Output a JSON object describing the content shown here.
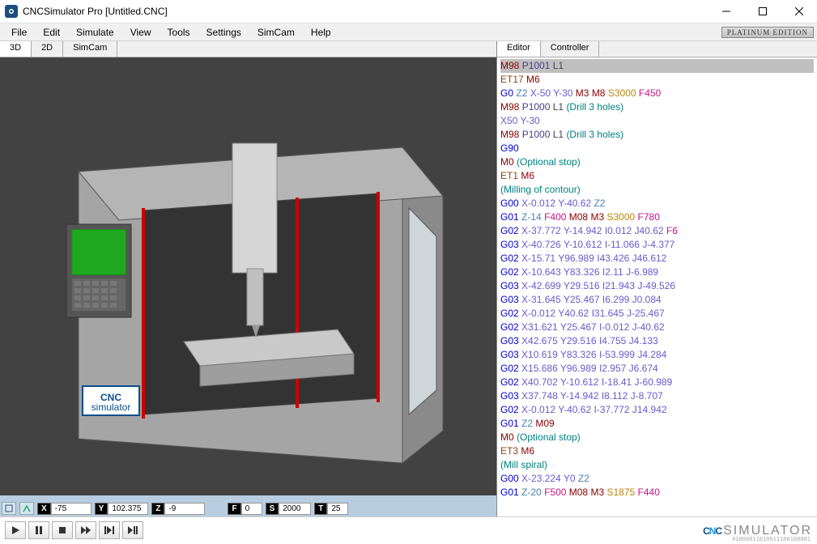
{
  "window": {
    "title": "CNCSimulator Pro [Untitled.CNC]",
    "edition_badge": "PLATINUM EDITION"
  },
  "menu": {
    "items": [
      "File",
      "Edit",
      "Simulate",
      "View",
      "Tools",
      "Settings",
      "SimCam",
      "Help"
    ]
  },
  "view_tabs": {
    "items": [
      "3D",
      "2D",
      "SimCam"
    ],
    "active_index": 0
  },
  "editor_tabs": {
    "items": [
      "Editor",
      "Controller"
    ],
    "active_index": 0
  },
  "status": {
    "X": {
      "label": "X",
      "value": "-75"
    },
    "Y": {
      "label": "Y",
      "value": "102.375"
    },
    "Z": {
      "label": "Z",
      "value": "-9"
    },
    "F": {
      "label": "F",
      "value": "0"
    },
    "S": {
      "label": "S",
      "value": "2000"
    },
    "T": {
      "label": "T",
      "value": "25"
    }
  },
  "code_lines": [
    {
      "hl": true,
      "tokens": [
        [
          "m",
          "M98"
        ],
        [
          "plain",
          " "
        ],
        [
          "p",
          "P1001"
        ],
        [
          "plain",
          " "
        ],
        [
          "l",
          "L1"
        ]
      ]
    },
    {
      "tokens": [
        [
          "et",
          "ET17"
        ],
        [
          "plain",
          " "
        ],
        [
          "m",
          "M6"
        ]
      ]
    },
    {
      "tokens": [
        [
          "g",
          "G0"
        ],
        [
          "plain",
          " "
        ],
        [
          "z",
          "Z2"
        ],
        [
          "plain",
          " "
        ],
        [
          "coord",
          "X-50"
        ],
        [
          "plain",
          " "
        ],
        [
          "coord",
          "Y-30"
        ],
        [
          "plain",
          " "
        ],
        [
          "m",
          "M3"
        ],
        [
          "plain",
          " "
        ],
        [
          "m",
          "M8"
        ],
        [
          "plain",
          " "
        ],
        [
          "s",
          "S3000"
        ],
        [
          "plain",
          " "
        ],
        [
          "f",
          "F450"
        ]
      ]
    },
    {
      "tokens": [
        [
          "m",
          "M98"
        ],
        [
          "plain",
          " "
        ],
        [
          "p",
          "P1000"
        ],
        [
          "plain",
          " "
        ],
        [
          "l",
          "L1"
        ],
        [
          "plain",
          " "
        ],
        [
          "comment",
          "(Drill 3 holes)"
        ]
      ]
    },
    {
      "tokens": [
        [
          "coord",
          "X50"
        ],
        [
          "plain",
          " "
        ],
        [
          "coord",
          "Y-30"
        ]
      ]
    },
    {
      "tokens": [
        [
          "m",
          "M98"
        ],
        [
          "plain",
          " "
        ],
        [
          "p",
          "P1000"
        ],
        [
          "plain",
          " "
        ],
        [
          "l",
          "L1"
        ],
        [
          "plain",
          " "
        ],
        [
          "comment",
          "(Drill 3 holes)"
        ]
      ]
    },
    {
      "tokens": [
        [
          "g",
          "G90"
        ]
      ]
    },
    {
      "tokens": [
        [
          "m",
          "M0"
        ],
        [
          "plain",
          " "
        ],
        [
          "comment",
          "(Optional stop)"
        ]
      ]
    },
    {
      "tokens": [
        [
          "et",
          "ET1"
        ],
        [
          "plain",
          " "
        ],
        [
          "m",
          "M6"
        ]
      ]
    },
    {
      "tokens": [
        [
          "comment",
          "(Milling of contour)"
        ]
      ]
    },
    {
      "tokens": [
        [
          "g",
          "G00"
        ],
        [
          "plain",
          " "
        ],
        [
          "coord",
          "X-0.012"
        ],
        [
          "plain",
          " "
        ],
        [
          "coord",
          "Y-40.62"
        ],
        [
          "plain",
          " "
        ],
        [
          "z",
          "Z2"
        ]
      ]
    },
    {
      "tokens": [
        [
          "g",
          "G01"
        ],
        [
          "plain",
          " "
        ],
        [
          "z",
          "Z-14"
        ],
        [
          "plain",
          " "
        ],
        [
          "f",
          "F400"
        ],
        [
          "plain",
          " "
        ],
        [
          "m",
          "M08"
        ],
        [
          "plain",
          " "
        ],
        [
          "m",
          "M3"
        ],
        [
          "plain",
          " "
        ],
        [
          "s",
          "S3000"
        ],
        [
          "plain",
          " "
        ],
        [
          "f",
          "F780"
        ]
      ]
    },
    {
      "tokens": [
        [
          "g",
          "G02"
        ],
        [
          "plain",
          " "
        ],
        [
          "coord",
          "X-37.772"
        ],
        [
          "plain",
          " "
        ],
        [
          "coord",
          "Y-14.942"
        ],
        [
          "plain",
          " "
        ],
        [
          "coord",
          "I0.012"
        ],
        [
          "plain",
          " "
        ],
        [
          "coord",
          "J40.62"
        ],
        [
          "plain",
          " "
        ],
        [
          "f",
          "F6"
        ]
      ]
    },
    {
      "tokens": [
        [
          "g",
          "G03"
        ],
        [
          "plain",
          " "
        ],
        [
          "coord",
          "X-40.726"
        ],
        [
          "plain",
          " "
        ],
        [
          "coord",
          "Y-10.612"
        ],
        [
          "plain",
          " "
        ],
        [
          "coord",
          "I-11.066"
        ],
        [
          "plain",
          " "
        ],
        [
          "coord",
          "J-4.377"
        ]
      ]
    },
    {
      "tokens": [
        [
          "g",
          "G02"
        ],
        [
          "plain",
          " "
        ],
        [
          "coord",
          "X-15.71"
        ],
        [
          "plain",
          " "
        ],
        [
          "coord",
          "Y96.989"
        ],
        [
          "plain",
          " "
        ],
        [
          "coord",
          "I43.426"
        ],
        [
          "plain",
          " "
        ],
        [
          "coord",
          "J46.612"
        ]
      ]
    },
    {
      "tokens": [
        [
          "g",
          "G02"
        ],
        [
          "plain",
          " "
        ],
        [
          "coord",
          "X-10.643"
        ],
        [
          "plain",
          " "
        ],
        [
          "coord",
          "Y83.326"
        ],
        [
          "plain",
          " "
        ],
        [
          "coord",
          "I2.11"
        ],
        [
          "plain",
          " "
        ],
        [
          "coord",
          "J-6.989"
        ]
      ]
    },
    {
      "tokens": [
        [
          "g",
          "G03"
        ],
        [
          "plain",
          " "
        ],
        [
          "coord",
          "X-42.699"
        ],
        [
          "plain",
          " "
        ],
        [
          "coord",
          "Y29.516"
        ],
        [
          "plain",
          " "
        ],
        [
          "coord",
          "I21.943"
        ],
        [
          "plain",
          " "
        ],
        [
          "coord",
          "J-49.526"
        ]
      ]
    },
    {
      "tokens": [
        [
          "g",
          "G03"
        ],
        [
          "plain",
          " "
        ],
        [
          "coord",
          "X-31.645"
        ],
        [
          "plain",
          " "
        ],
        [
          "coord",
          "Y25.467"
        ],
        [
          "plain",
          " "
        ],
        [
          "coord",
          "I6.299"
        ],
        [
          "plain",
          " "
        ],
        [
          "coord",
          "J0.084"
        ]
      ]
    },
    {
      "tokens": [
        [
          "g",
          "G02"
        ],
        [
          "plain",
          " "
        ],
        [
          "coord",
          "X-0.012"
        ],
        [
          "plain",
          " "
        ],
        [
          "coord",
          "Y40.62"
        ],
        [
          "plain",
          " "
        ],
        [
          "coord",
          "I31.645"
        ],
        [
          "plain",
          " "
        ],
        [
          "coord",
          "J-25.467"
        ]
      ]
    },
    {
      "tokens": [
        [
          "g",
          "G02"
        ],
        [
          "plain",
          " "
        ],
        [
          "coord",
          "X31.621"
        ],
        [
          "plain",
          " "
        ],
        [
          "coord",
          "Y25.467"
        ],
        [
          "plain",
          " "
        ],
        [
          "coord",
          "I-0.012"
        ],
        [
          "plain",
          " "
        ],
        [
          "coord",
          "J-40.62"
        ]
      ]
    },
    {
      "tokens": [
        [
          "g",
          "G03"
        ],
        [
          "plain",
          " "
        ],
        [
          "coord",
          "X42.675"
        ],
        [
          "plain",
          " "
        ],
        [
          "coord",
          "Y29.516"
        ],
        [
          "plain",
          " "
        ],
        [
          "coord",
          "I4.755"
        ],
        [
          "plain",
          " "
        ],
        [
          "coord",
          "J4.133"
        ]
      ]
    },
    {
      "tokens": [
        [
          "g",
          "G03"
        ],
        [
          "plain",
          " "
        ],
        [
          "coord",
          "X10.619"
        ],
        [
          "plain",
          " "
        ],
        [
          "coord",
          "Y83.326"
        ],
        [
          "plain",
          " "
        ],
        [
          "coord",
          "I-53.999"
        ],
        [
          "plain",
          " "
        ],
        [
          "coord",
          "J4.284"
        ]
      ]
    },
    {
      "tokens": [
        [
          "g",
          "G02"
        ],
        [
          "plain",
          " "
        ],
        [
          "coord",
          "X15.686"
        ],
        [
          "plain",
          " "
        ],
        [
          "coord",
          "Y96.989"
        ],
        [
          "plain",
          " "
        ],
        [
          "coord",
          "I2.957"
        ],
        [
          "plain",
          " "
        ],
        [
          "coord",
          "J6.674"
        ]
      ]
    },
    {
      "tokens": [
        [
          "g",
          "G02"
        ],
        [
          "plain",
          " "
        ],
        [
          "coord",
          "X40.702"
        ],
        [
          "plain",
          " "
        ],
        [
          "coord",
          "Y-10.612"
        ],
        [
          "plain",
          " "
        ],
        [
          "coord",
          "I-18.41"
        ],
        [
          "plain",
          " "
        ],
        [
          "coord",
          "J-60.989"
        ]
      ]
    },
    {
      "tokens": [
        [
          "g",
          "G03"
        ],
        [
          "plain",
          " "
        ],
        [
          "coord",
          "X37.748"
        ],
        [
          "plain",
          " "
        ],
        [
          "coord",
          "Y-14.942"
        ],
        [
          "plain",
          " "
        ],
        [
          "coord",
          "I8.112"
        ],
        [
          "plain",
          " "
        ],
        [
          "coord",
          "J-8.707"
        ]
      ]
    },
    {
      "tokens": [
        [
          "g",
          "G02"
        ],
        [
          "plain",
          " "
        ],
        [
          "coord",
          "X-0.012"
        ],
        [
          "plain",
          " "
        ],
        [
          "coord",
          "Y-40.62"
        ],
        [
          "plain",
          " "
        ],
        [
          "coord",
          "I-37.772"
        ],
        [
          "plain",
          " "
        ],
        [
          "coord",
          "J14.942"
        ]
      ]
    },
    {
      "tokens": [
        [
          "g",
          "G01"
        ],
        [
          "plain",
          " "
        ],
        [
          "z",
          "Z2"
        ],
        [
          "plain",
          " "
        ],
        [
          "m",
          "M09"
        ]
      ]
    },
    {
      "tokens": [
        [
          "m",
          "M0"
        ],
        [
          "plain",
          " "
        ],
        [
          "comment",
          "(Optional stop)"
        ]
      ]
    },
    {
      "tokens": [
        [
          "et",
          "ET3"
        ],
        [
          "plain",
          " "
        ],
        [
          "m",
          "M6"
        ]
      ]
    },
    {
      "tokens": [
        [
          "comment",
          "(Mill spiral)"
        ]
      ]
    },
    {
      "tokens": [
        [
          "g",
          "G00"
        ],
        [
          "plain",
          " "
        ],
        [
          "coord",
          "X-23.224"
        ],
        [
          "plain",
          " "
        ],
        [
          "coord",
          "Y0"
        ],
        [
          "plain",
          " "
        ],
        [
          "z",
          "Z2"
        ]
      ]
    },
    {
      "tokens": [
        [
          "g",
          "G01"
        ],
        [
          "plain",
          " "
        ],
        [
          "z",
          "Z-20"
        ],
        [
          "plain",
          " "
        ],
        [
          "f",
          "F500"
        ],
        [
          "plain",
          " "
        ],
        [
          "m",
          "M08"
        ],
        [
          "plain",
          " "
        ],
        [
          "m",
          "M3"
        ],
        [
          "plain",
          " "
        ],
        [
          "s",
          "S1875"
        ],
        [
          "plain",
          " "
        ],
        [
          "f",
          "F440"
        ]
      ]
    }
  ],
  "playback_icons": [
    "play",
    "pause",
    "stop",
    "fast-forward",
    "step-forward",
    "step-run"
  ],
  "brand": {
    "cnc": "CNC",
    "sim": "SIMULATOR",
    "binary": "01000011010011100100001"
  },
  "machine_logo": {
    "line1": "CNC",
    "line2": "simulator"
  }
}
